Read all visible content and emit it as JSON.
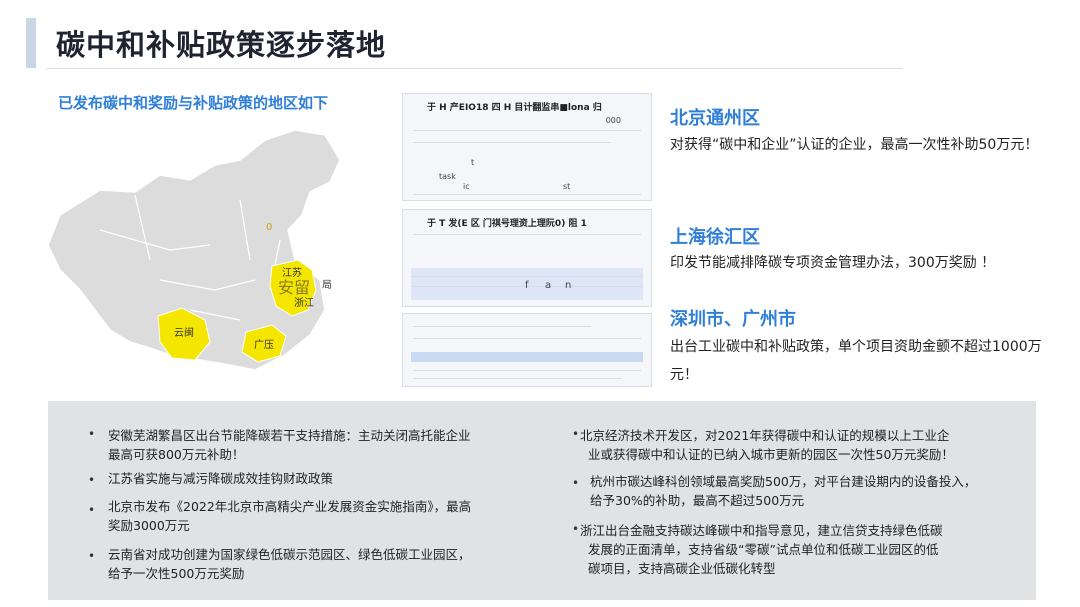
{
  "header": {
    "title": "碳中和补贴政策逐步落地"
  },
  "subtitle": "已发布碳中和奖励与补贴政策的地区如下",
  "map": {
    "labels": {
      "jiangsu": "江苏",
      "anhui": "安留",
      "zhejiang": "浙江",
      "yunnan": "云闽",
      "guangdong": "广压",
      "ju": "局",
      "zero": "0"
    },
    "highlight_color": "#f5e600"
  },
  "docs": [
    {
      "header": "于 H  产EIO18     四  H   目计翻监串■lona 归",
      "num": "000",
      "t1": "t",
      "t2": "task",
      "t3": "ic",
      "t4": "st"
    },
    {
      "header": "于 T 发(E   区      门祺号理资上理阮0)   阻    1",
      "t1": "f",
      "t2": "a",
      "t3": "n"
    },
    {
      "header": ""
    }
  ],
  "regions": [
    {
      "name": "北京通州区",
      "desc": "对获得“碳中和企业”认证的企业，最高一次性补助50万元！"
    },
    {
      "name": "上海徐汇区",
      "desc": "印发节能减排降碳专项资金管理办法，300万奖励 ！"
    },
    {
      "name": "深圳市、广州市",
      "desc": "出台工业碳中和补贴政策，单个项目资助金颤不超过1000万元！"
    }
  ],
  "bullets_left": [
    {
      "line1": "安徽芜湖繁昌区出台节能降碳若干支持措施：主动关闭高托能企业",
      "line2": "最高可获800万元补助！"
    },
    {
      "line1": "江苏省实施与减污降碳成效挂钩财政政策",
      "line2": ""
    },
    {
      "line1": "北京市发布《2022年北京市高精尖产业发展资金实施指南》，最高",
      "line2": "奖励3000万元"
    },
    {
      "line1": "云南省对成功创建为国家绿色低碳示范园区、绿色低碳工业园区，",
      "line2": "给予一次性500万元奖励"
    }
  ],
  "bullets_right": [
    {
      "line1": "北京经济技术开发区，对2021年获得碳中和认证的规模以上工业企",
      "line2": "业或获得碳中和认证的已纳入城市更新的园区一次性50万元奖励！",
      "line3": ""
    },
    {
      "line1": "杭州市碳达峰科创领域最高奖励500万，对平台建设期内的设备投入，",
      "line2": "给予30%的补助，最高不超过500万元",
      "line3": ""
    },
    {
      "line1": "浙江出台金融支持碳达峰碳中和指导意见，建立信贷支持绿色低碳",
      "line2": "发展的正面清单，支持省级“零碳”试点单位和低碳工业园区的低",
      "line3": "碳项目，支持高碳企业低碳化转型"
    }
  ],
  "bullet_char": "•"
}
